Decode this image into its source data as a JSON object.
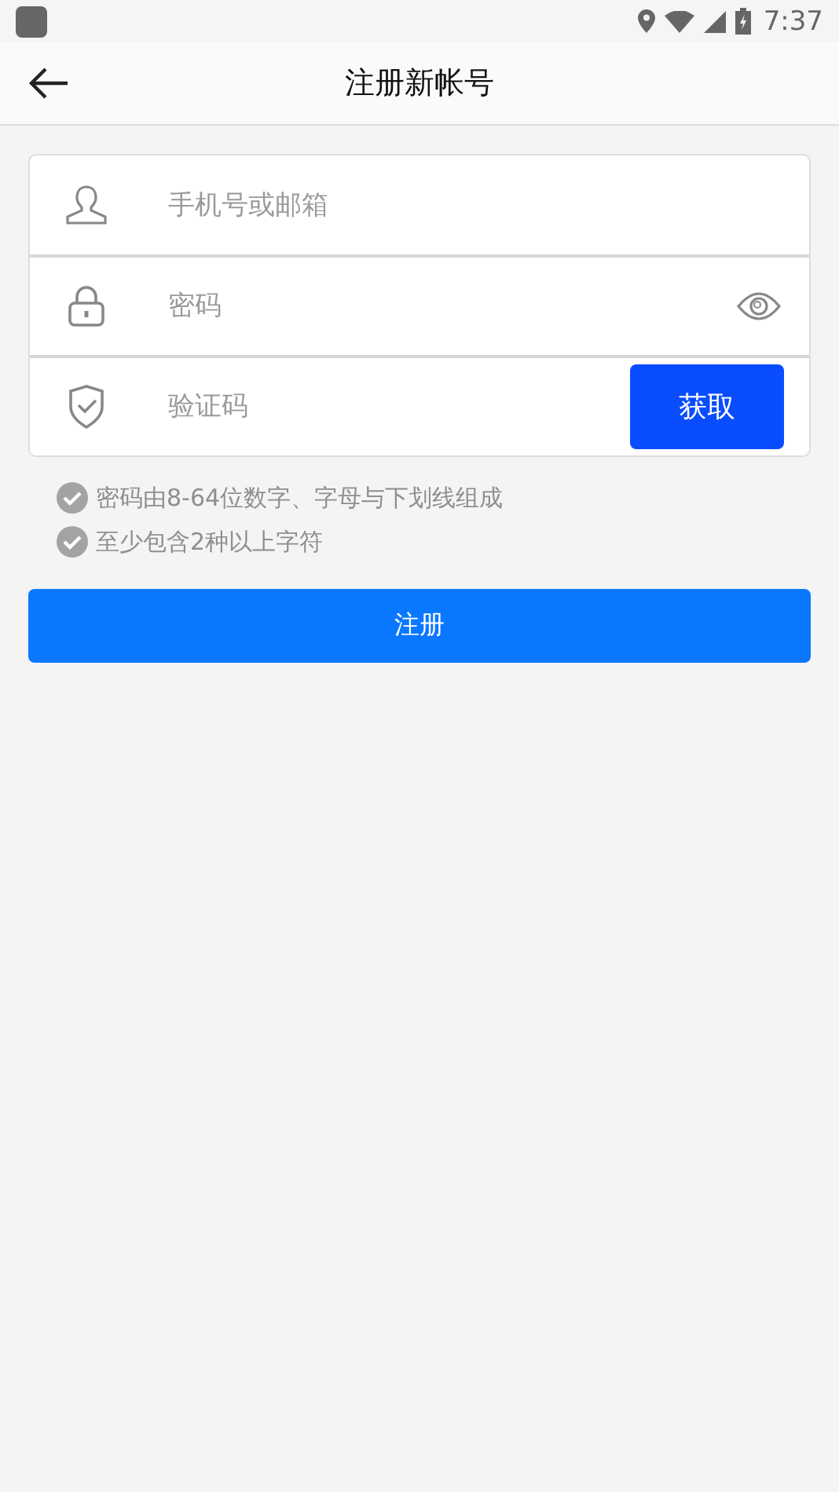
{
  "status_bar": {
    "time": "7:37"
  },
  "app_bar": {
    "title": "注册新帐号"
  },
  "fields": [
    {
      "kind": "user",
      "placeholder": "手机号或邮箱"
    },
    {
      "kind": "password",
      "placeholder": "密码"
    },
    {
      "kind": "code",
      "placeholder": "验证码",
      "button": "获取"
    }
  ],
  "rules": [
    {
      "text": "密码由8-64位数字、字母与下划线组成",
      "met": false
    },
    {
      "text": "至少包含2种以上字符",
      "met": false
    }
  ],
  "submit": "注册"
}
